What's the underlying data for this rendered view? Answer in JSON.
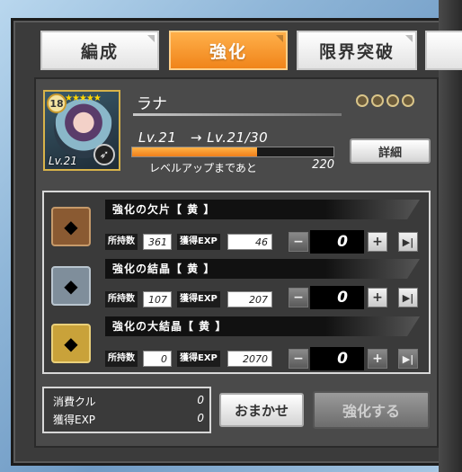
{
  "tabs": [
    {
      "label": "編成",
      "active": false
    },
    {
      "label": "強化",
      "active": true
    },
    {
      "label": "限界突破",
      "active": false
    }
  ],
  "character": {
    "name": "ラナ",
    "badge_level": "18",
    "stars": "★★★★★",
    "card_level": "Lv.21",
    "level_text": "Lv.21　→ Lv.21/30",
    "exp_progress": 0.62,
    "next_label": "レベルアップまであと",
    "next_value": "220",
    "detail_button": "詳細",
    "limit_rings": 4
  },
  "materials": [
    {
      "name": "強化の欠片【 黄 】",
      "owned_label": "所持数",
      "owned": "361",
      "exp_label": "獲得EXP",
      "exp": "46",
      "qty": "0",
      "icon_color": "#8a5a32"
    },
    {
      "name": "強化の結晶【 黄 】",
      "owned_label": "所持数",
      "owned": "107",
      "exp_label": "獲得EXP",
      "exp": "207",
      "qty": "0",
      "icon_color": "#7f8e9b"
    },
    {
      "name": "強化の大結晶【 黄 】",
      "owned_label": "所持数",
      "owned": "0",
      "exp_label": "獲得EXP",
      "exp": "2070",
      "qty": "0",
      "icon_color": "#c9a23a"
    }
  ],
  "summary": {
    "cost_label": "消費クル",
    "cost_value": "0",
    "exp_label": "獲得EXP",
    "exp_value": "0"
  },
  "buttons": {
    "auto": "おまかせ",
    "enhance": "強化する"
  },
  "icons": {
    "minus": "−",
    "plus": "+",
    "max": "▶|"
  }
}
